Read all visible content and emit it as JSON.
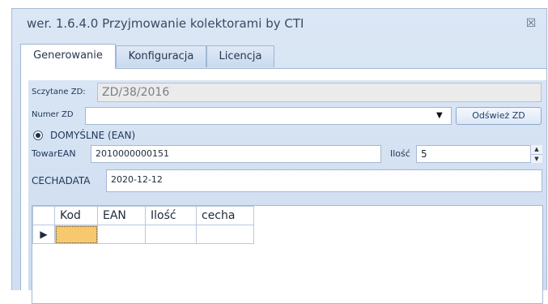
{
  "window": {
    "title": "wer. 1.6.4.0 Przyjmowanie kolektorami by CTI",
    "close_glyph": "☒"
  },
  "tabs": [
    {
      "label": "Generowanie",
      "active": true
    },
    {
      "label": "Konfiguracja",
      "active": false
    },
    {
      "label": "Licencja",
      "active": false
    }
  ],
  "form": {
    "scanned_label": "Sczytane ZD:",
    "scanned_value": "ZD/38/2016",
    "number_label": "Numer ZD",
    "number_value": "",
    "refresh_label": "Odśwież ZD",
    "radio_label": "DOMYŚLNE (EAN)",
    "towar_label": "TowarEAN",
    "towar_value": "2010000000151",
    "qty_label": "Ilość",
    "qty_value": "5",
    "cecha_label": "CECHADATA",
    "cecha_value": "2020-12-12"
  },
  "grid": {
    "columns": [
      "Kod",
      "EAN",
      "Ilość",
      "cecha"
    ],
    "row_indicator": "▶"
  }
}
